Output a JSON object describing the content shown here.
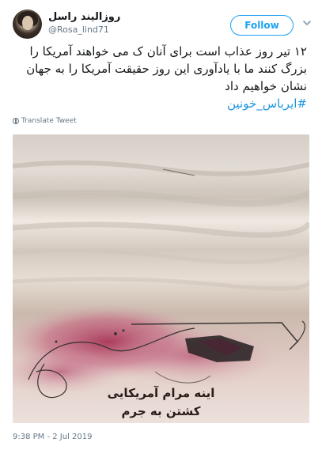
{
  "author": {
    "display_name": "روزالیند راسل",
    "handle": "@Rosa_lind71",
    "avatar_icon": "avatar-photo"
  },
  "follow_button": {
    "label": "Follow",
    "color": "#1da1f2"
  },
  "menu_icon": "chevron-down-icon",
  "tweet": {
    "text": "۱۲ تیر روز عذاب است برای آنان ک می خواهند آمریکا را بزرگ کنند ما با یادآوری این روز حقیقت آمریکا را به جهان نشان خواهیم داد",
    "hashtag": "#ایرباس_خونین",
    "hashtag_color": "#1b95e0"
  },
  "translate_label": "Translate Tweet",
  "media": {
    "caption_line1": "اینه مرام آمریکایی",
    "caption_line2": "کشتن به جرم"
  },
  "timestamp": "9:38 PM - 2 Jul 2019"
}
